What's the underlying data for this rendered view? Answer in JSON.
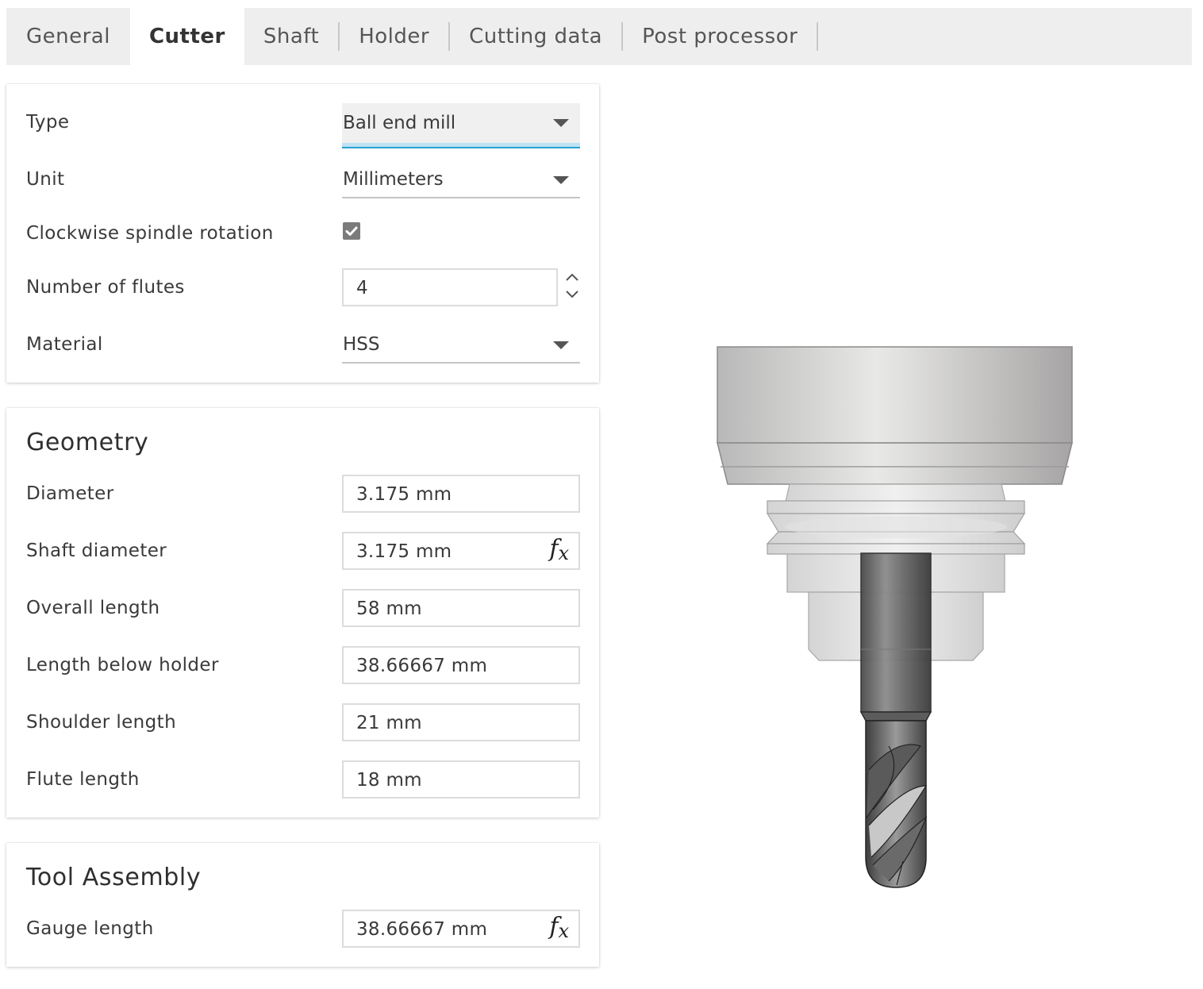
{
  "tabs": [
    {
      "label": "General",
      "active": false
    },
    {
      "label": "Cutter",
      "active": true
    },
    {
      "label": "Shaft",
      "active": false
    },
    {
      "label": "Holder",
      "active": false
    },
    {
      "label": "Cutting data",
      "active": false
    },
    {
      "label": "Post processor",
      "active": false
    }
  ],
  "cutter": {
    "type_label": "Type",
    "type_value": "Ball end mill",
    "unit_label": "Unit",
    "unit_value": "Millimeters",
    "clockwise_label": "Clockwise spindle rotation",
    "clockwise_checked": true,
    "flutes_label": "Number of flutes",
    "flutes_value": "4",
    "material_label": "Material",
    "material_value": "HSS"
  },
  "geometry": {
    "title": "Geometry",
    "diameter_label": "Diameter",
    "diameter_value": "3.175 mm",
    "shaft_diameter_label": "Shaft diameter",
    "shaft_diameter_value": "3.175 mm",
    "overall_length_label": "Overall length",
    "overall_length_value": "58 mm",
    "length_below_holder_label": "Length below holder",
    "length_below_holder_value": "38.66667 mm",
    "shoulder_length_label": "Shoulder length",
    "shoulder_length_value": "21 mm",
    "flute_length_label": "Flute length",
    "flute_length_value": "18 mm"
  },
  "assembly": {
    "title": "Tool Assembly",
    "gauge_length_label": "Gauge length",
    "gauge_length_value": "38.66667 mm"
  },
  "fx_label": "f",
  "fx_sub": "x",
  "icons": [
    "chevron-up-icon",
    "chevron-down-icon",
    "checkmark-icon",
    "dropdown-caret-icon"
  ],
  "colors": {
    "focus_accent": "#2b9fd0",
    "focus_underline": "#bde3f2",
    "tab_bar": "#eeeeee"
  }
}
